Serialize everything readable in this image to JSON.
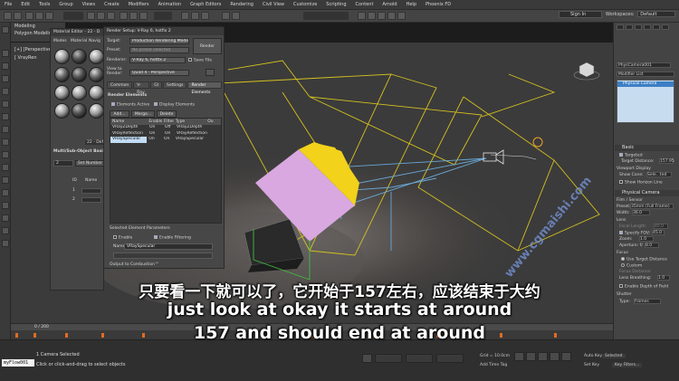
{
  "menubar": {
    "items": [
      "File",
      "Edit",
      "Tools",
      "Group",
      "Views",
      "Create",
      "Modifiers",
      "Animation",
      "Graph Editors",
      "Rendering",
      "Civil View",
      "Customize",
      "Scripting",
      "Content",
      "Arnold",
      "Help",
      "Phoenix FD"
    ],
    "sign_in": "Sign In",
    "workspaces_label": "Workspaces:",
    "workspaces_value": "Default"
  },
  "ribbon": {
    "tab": "Modeling",
    "sub": "Polygon Modelin"
  },
  "viewport": {
    "label": "[+] [Perspective] [S",
    "label2": "[ VrayRen"
  },
  "material_editor": {
    "title": "Material Editor - 22 - D",
    "menu": [
      "Modes",
      "Material",
      "Navig"
    ],
    "slot_label": "22 - Defa",
    "section": "Multi/Sub-Object Basic",
    "count": "2",
    "set_number": "Set Number",
    "id_header": "ID",
    "name_header": "Name",
    "ids": [
      "1",
      "2"
    ]
  },
  "render_setup": {
    "title": "Render Setup: V-Ray 6, hotfix 2",
    "target_label": "Target:",
    "target_value": "Production Rendering Mode",
    "preset_label": "Preset:",
    "preset_value": "No preset selected",
    "renderer_label": "Renderer:",
    "renderer_value": "V-Ray 6, hotfix 2",
    "save_file": "Save File",
    "view_label": "View to Render:",
    "view_value": "Quad 4 - Perspective",
    "render_button": "Render",
    "tabs": [
      "Common",
      "V-Ray",
      "GI",
      "Settings",
      "Render Elements"
    ],
    "rollout": "Render Elements",
    "elements_active": "Elements Active",
    "display_elements": "Display Elements",
    "add": "Add...",
    "merge": "Merge...",
    "delete": "Delete",
    "columns": [
      "Name",
      "Enabled",
      "Filter",
      "Type",
      "Ou"
    ],
    "rows": [
      {
        "name": "VRayZDepth",
        "enabled": "On",
        "filter": "Off",
        "type": "VRayZDepth"
      },
      {
        "name": "VRayReflection",
        "enabled": "On",
        "filter": "On",
        "type": "VRayReflection"
      },
      {
        "name": "VRaySpecular",
        "enabled": "On",
        "filter": "On",
        "type": "VRaySpecular"
      }
    ],
    "selected_params": "Selected Element Parameters",
    "enable": "Enable",
    "enable_filtering": "Enable Filtering",
    "name_label": "Name:",
    "name_value": "VRaySpecular",
    "output_combustion": "Output to Combustion™"
  },
  "command_panel": {
    "object_name": "PhysCamera001",
    "modifier_list": "Modifier List",
    "stack_item": "Physical Camera",
    "basic": "Basic",
    "targeted": "Targeted",
    "target_distance_label": "Target Distance:",
    "target_distance": "157.95",
    "viewport_display": "Viewport Display",
    "show_cone": "Show Cone:",
    "show_cone_value": "Sele...ted",
    "show_horizon": "Show Horizon Line",
    "physical_camera": "Physical Camera",
    "film_sensor": "Film / Sensor",
    "preset_label": "Preset:",
    "preset_value": "35mm (Full Frame)",
    "width_label": "Width:",
    "width_value": "36.0",
    "lens": "Lens",
    "focal_length_label": "Focal Length:",
    "focal_length": "40.0",
    "specify_fov": "Specify FOV:",
    "fov_value": "45.0",
    "zoom_label": "Zoom:",
    "zoom_value": "1.0",
    "aperture_label": "Aperture: f/",
    "aperture_value": "8.0",
    "focus": "Focus",
    "use_target_distance": "Use Target Distance",
    "custom": "Custom",
    "focus_distance_label": "Focus Distance:",
    "lens_breathing_label": "Lens Breathing:",
    "lens_breathing_value": "1.0",
    "enable_dof": "Enable Depth of Field",
    "shutter": "Shutter",
    "type_label": "Type:",
    "type_value": "frames"
  },
  "timeline": {
    "position": "0 / 200"
  },
  "statusbar": {
    "maxscript": "myFlow001",
    "selection": "1 Camera Selected",
    "prompt": "Click or click-and-drag to select objects",
    "grid": "Grid = 10.0cm",
    "add_time_tag": "Add Time Tag",
    "auto_key": "Auto Key",
    "set_key": "Set Key",
    "selected": "Selected",
    "key_filters": "Key Filters..."
  },
  "subtitles": {
    "chinese": "只要看一下就可以了，它开始于157左右，应该结束于大约",
    "english_line1": "just look at okay it starts at around",
    "english_line2": "157 and should end at around"
  },
  "watermark": "www.cgmaishi.com",
  "colors": {
    "wire_yellow": "#d4c021",
    "wire_cyan": "#6aa7d6",
    "plane_purple": "#d9a8e0",
    "paint_yellow": "#f2d21a",
    "selection_blue": "#c3dcf5"
  }
}
